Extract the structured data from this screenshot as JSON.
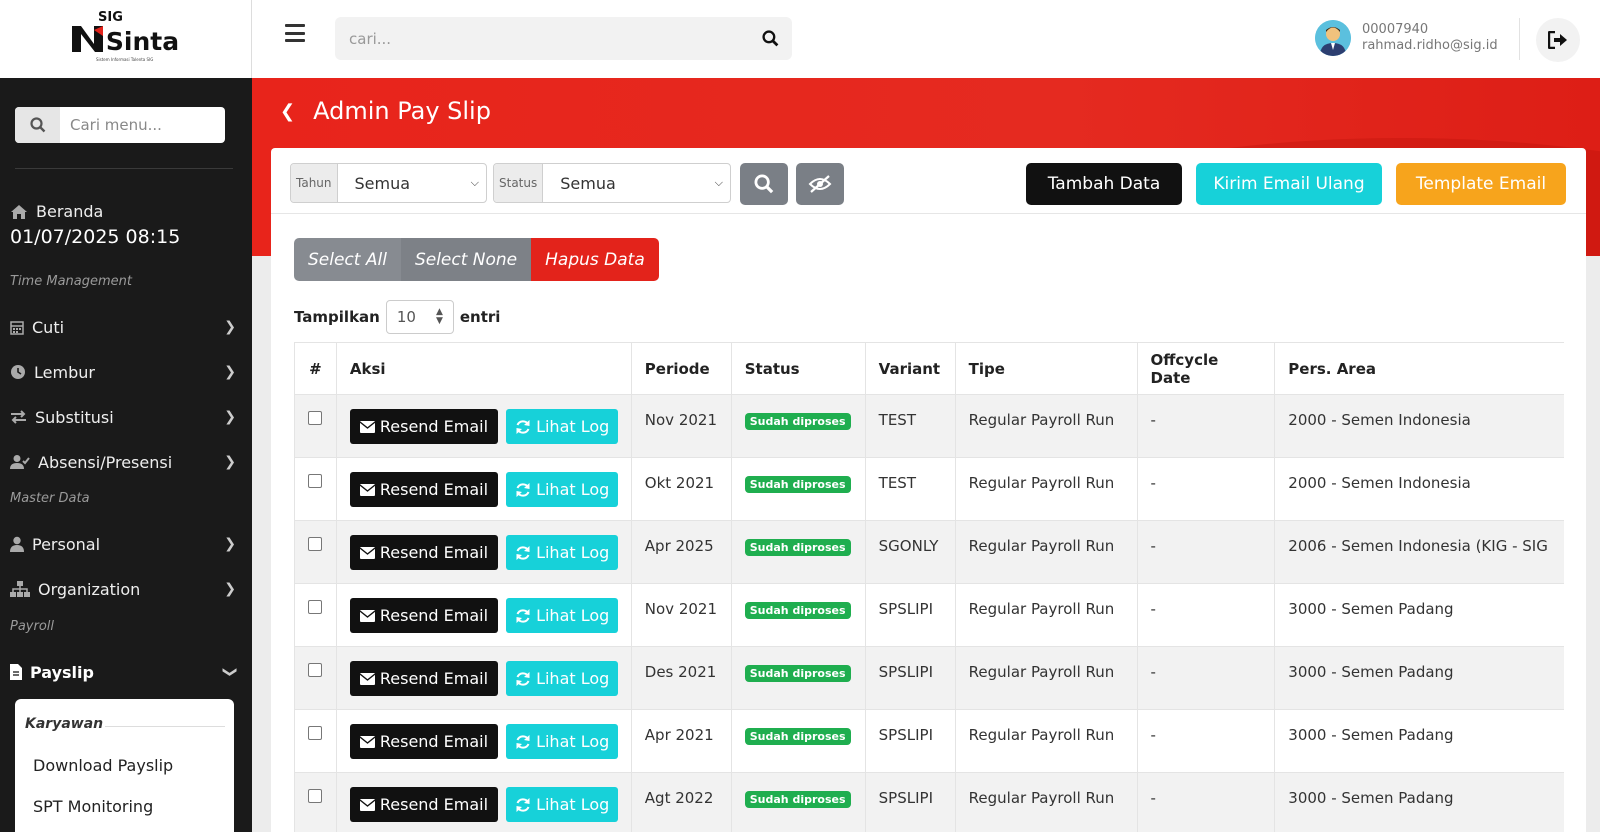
{
  "logo": {
    "brand": "SIG",
    "name": "Sinta",
    "tagline": "Sistem Informasi Talenta SIG"
  },
  "sidebar": {
    "search_placeholder": "Cari menu...",
    "home_label": "Beranda",
    "datetime": "01/07/2025 08:15",
    "sections": {
      "time": "Time Management",
      "master": "Master Data",
      "payroll": "Payroll"
    },
    "items": {
      "cuti": "Cuti",
      "lembur": "Lembur",
      "substitusi": "Substitusi",
      "absensi": "Absensi/Presensi",
      "personal": "Personal",
      "organization": "Organization",
      "payslip": "Payslip"
    },
    "submenu": {
      "heading": "Karyawan",
      "items": [
        "Download Payslip",
        "SPT Monitoring"
      ]
    }
  },
  "topbar": {
    "search_placeholder": "cari...",
    "user_id": "00007940",
    "user_email": "rahmad.ridho@sig.id"
  },
  "page": {
    "title": "Admin Pay Slip"
  },
  "filters": {
    "year_label": "Tahun",
    "year_value": "Semua",
    "status_label": "Status",
    "status_value": "Semua"
  },
  "buttons": {
    "add": "Tambah Data",
    "resend_all": "Kirim Email Ulang",
    "template": "Template Email",
    "select_all": "Select All",
    "select_none": "Select None",
    "delete": "Hapus Data"
  },
  "entries": {
    "prefix": "Tampilkan",
    "value": "10",
    "suffix": "entri"
  },
  "table": {
    "headers": [
      "#",
      "Aksi",
      "Periode",
      "Status",
      "Variant",
      "Tipe",
      "Offcycle Date",
      "Pers. Area"
    ],
    "resend_label": "Resend Email",
    "log_label": "Lihat Log",
    "rows": [
      {
        "periode": "Nov 2021",
        "status": "Sudah diproses",
        "variant": "TEST",
        "tipe": "Regular Payroll Run",
        "offcycle": "-",
        "area": "2000 - Semen Indonesia"
      },
      {
        "periode": "Okt 2021",
        "status": "Sudah diproses",
        "variant": "TEST",
        "tipe": "Regular Payroll Run",
        "offcycle": "-",
        "area": "2000 - Semen Indonesia"
      },
      {
        "periode": "Apr 2025",
        "status": "Sudah diproses",
        "variant": "SGONLY",
        "tipe": "Regular Payroll Run",
        "offcycle": "-",
        "area": "2006 - Semen Indonesia (KIG - SIG"
      },
      {
        "periode": "Nov 2021",
        "status": "Sudah diproses",
        "variant": "SPSLIPI",
        "tipe": "Regular Payroll Run",
        "offcycle": "-",
        "area": "3000 - Semen Padang"
      },
      {
        "periode": "Des 2021",
        "status": "Sudah diproses",
        "variant": "SPSLIPI",
        "tipe": "Regular Payroll Run",
        "offcycle": "-",
        "area": "3000 - Semen Padang"
      },
      {
        "periode": "Apr 2021",
        "status": "Sudah diproses",
        "variant": "SPSLIPI",
        "tipe": "Regular Payroll Run",
        "offcycle": "-",
        "area": "3000 - Semen Padang"
      },
      {
        "periode": "Agt 2022",
        "status": "Sudah diproses",
        "variant": "SPSLIPI",
        "tipe": "Regular Payroll Run",
        "offcycle": "-",
        "area": "3000 - Semen Padang"
      }
    ]
  }
}
